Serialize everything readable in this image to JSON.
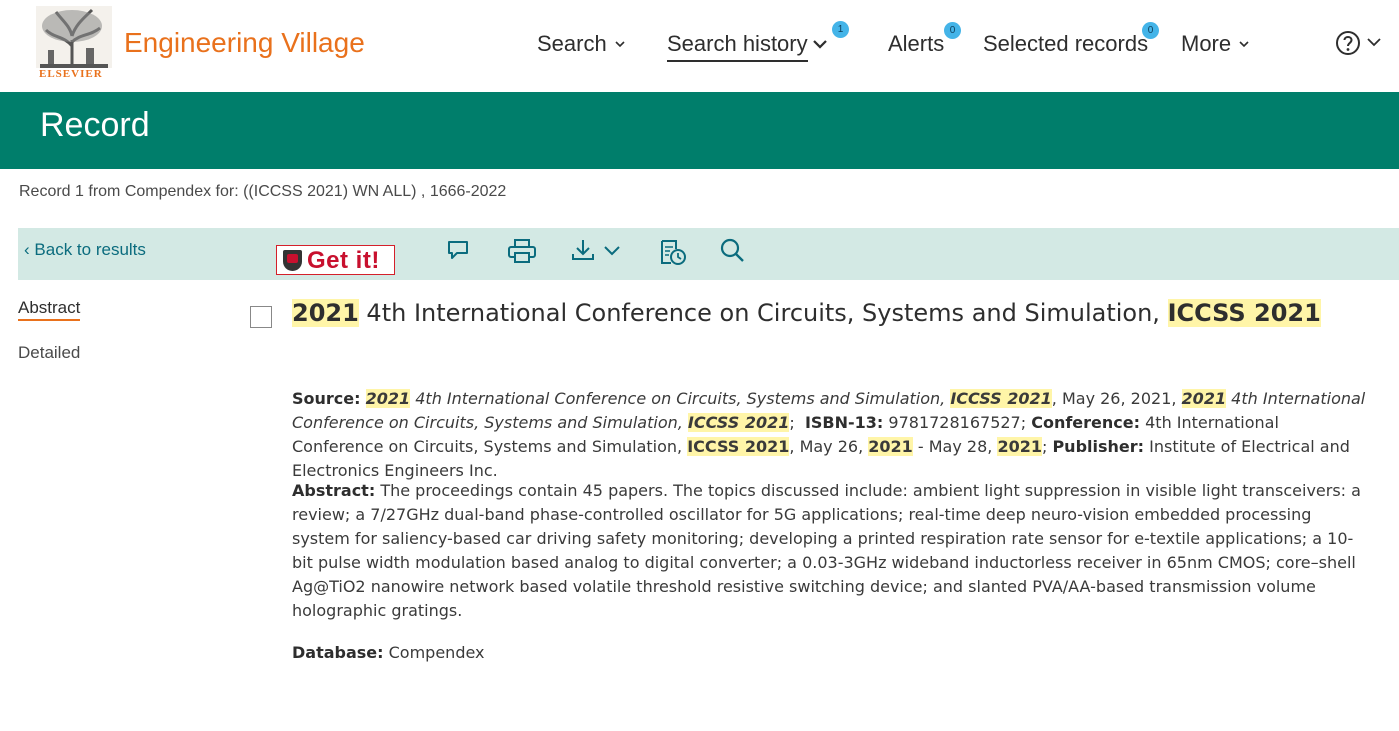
{
  "brand": {
    "logo_text": "ELSEVIER",
    "name": "Engineering Village",
    "color": "#e9711c"
  },
  "nav": {
    "search": "Search",
    "history": "Search history",
    "history_count": "1",
    "alerts": "Alerts",
    "alerts_count": "0",
    "selected": "Selected records",
    "selected_count": "0",
    "more": "More"
  },
  "header": {
    "title": "Record",
    "band_color": "#007e6b"
  },
  "record_line": "Record 1 from Compendex for: ((ICCSS 2021) WN ALL) , 1666-2022",
  "toolbar": {
    "back": "Back to results",
    "getit": "Get it!"
  },
  "sidenav": {
    "abstract": "Abstract",
    "detailed": "Detailed"
  },
  "record": {
    "title_year": "2021",
    "title_mid": " 4th International Conference on Circuits, Systems and Simulation, ",
    "title_acronym": "ICCSS 2021",
    "source_label": "Source:",
    "src_y1": "2021",
    "src_t1": " 4th International Conference on Circuits, Systems and Simulation, ",
    "src_a1": "ICCSS 2021",
    "src_d1": ", May 26, 2021, ",
    "src_y2": "2021",
    "src_t2": " 4th International Conference on Circuits, Systems and Simulation, ",
    "src_a2": "ICCSS 2021",
    "isbn_label": "ISBN-13:",
    "isbn": " 9781728167527; ",
    "conf_label": "Conference:",
    "conf_text": " 4th International Conference on Circuits, Systems and Simulation, ",
    "conf_a": "ICCSS 2021",
    "conf_d1": ", May 26, ",
    "conf_y1": "2021",
    "conf_d2": " - May 28, ",
    "conf_y2": "2021",
    "publisher_label": "Publisher:",
    "publisher": " Institute of Electrical and Electronics Engineers Inc.",
    "abstract_label": "Abstract:",
    "abstract": " The proceedings contain 45 papers. The topics discussed include: ambient light suppression in visible light transceivers: a review; a 7/27GHz dual-band phase-controlled oscillator for 5G applications; real-time deep neuro-vision embedded processing system for saliency-based car driving safety monitoring; developing a printed respiration rate sensor for e-textile applications; a 10-bit pulse width modulation based analog to digital converter; a 0.03-3GHz wideband inductorless receiver in 65nm CMOS; core–shell Ag@TiO2 nanowire network based volatile threshold resistive switching device; and slanted PVA/AA-based transmission volume holographic gratings.",
    "db_label": "Database:",
    "db": " Compendex"
  }
}
